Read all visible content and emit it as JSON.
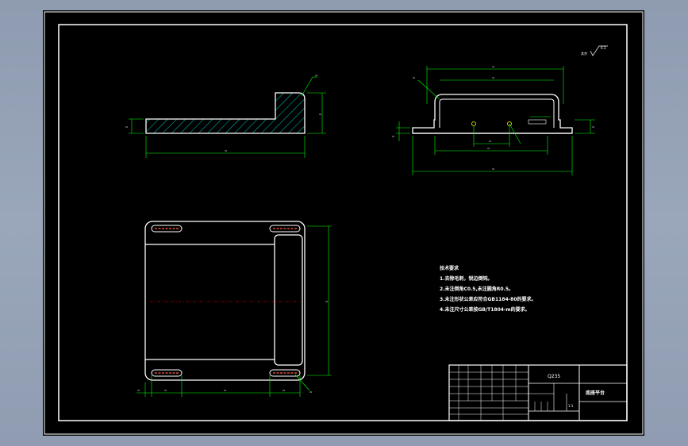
{
  "technical_requirements": {
    "title": "技术要求",
    "items": [
      "1.去除毛刺，锐边倒钝。",
      "2.未注倒角C0.5,未注圆角R0.5。",
      "3.未注形状公差应符合GB1184-80的要求。",
      "4.未注尺寸公差按GB/T1804-m的要求。"
    ]
  },
  "surface_finish": {
    "label": "其余",
    "value": "6.3"
  },
  "title_block": {
    "material": "Q235",
    "part_name": "底座平台",
    "scale": "1:1"
  },
  "colors": {
    "background": "#000000",
    "outline": "#ffffff",
    "dimension": "#00ff00",
    "hatch": "#00ffff",
    "center_line": "#ff0000",
    "slot": "#ff6040",
    "window": "#94a2b6"
  }
}
